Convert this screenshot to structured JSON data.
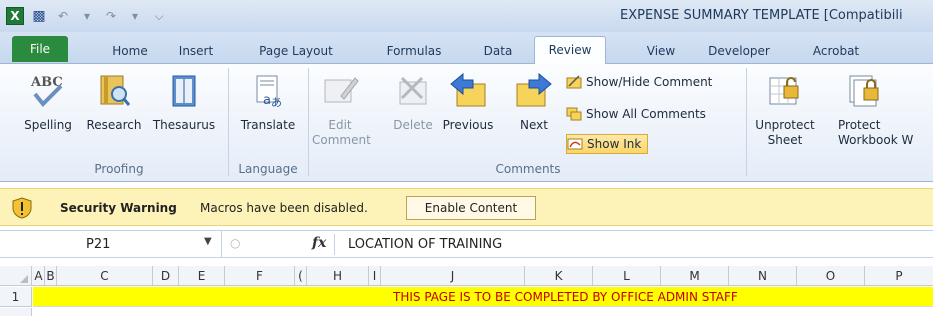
{
  "window": {
    "title": "EXPENSE SUMMARY TEMPLATE  [Compatibili"
  },
  "tabs": [
    {
      "label": "File"
    },
    {
      "label": "Home"
    },
    {
      "label": "Insert"
    },
    {
      "label": "Page Layout"
    },
    {
      "label": "Formulas"
    },
    {
      "label": "Data"
    },
    {
      "label": "Review"
    },
    {
      "label": "View"
    },
    {
      "label": "Developer"
    },
    {
      "label": "Acrobat"
    }
  ],
  "ribbon": {
    "proofing": {
      "label": "Proofing",
      "spelling": "Spelling",
      "research": "Research",
      "thesaurus": "Thesaurus"
    },
    "language": {
      "label": "Language",
      "translate": "Translate"
    },
    "comments": {
      "label": "Comments",
      "edit_line1": "Edit",
      "edit_line2": "Comment",
      "delete": "Delete",
      "previous": "Previous",
      "next": "Next",
      "show_hide": "Show/Hide Comment",
      "show_all": "Show All Comments",
      "show_ink": "Show Ink"
    },
    "changes": {
      "unprotect_line1": "Unprotect",
      "unprotect_line2": "Sheet",
      "protect_line1": "Protect",
      "protect_line2": "Workbook W"
    }
  },
  "security_bar": {
    "title": "Security Warning",
    "message": "Macros have been disabled.",
    "button": "Enable Content"
  },
  "formula_bar": {
    "name_box": "P21",
    "fx": "fx",
    "formula": "LOCATION OF TRAINING"
  },
  "grid": {
    "columns": [
      "A",
      "B",
      "C",
      "D",
      "E",
      "F",
      "(",
      "H",
      "I",
      "J",
      "K",
      "L",
      "M",
      "N",
      "O",
      "P"
    ],
    "row1_number": "1",
    "row1_text": "THIS PAGE IS TO BE COMPLETED BY OFFICE ADMIN STAFF"
  },
  "colors": {
    "accent_file_tab": "#2a8a3d",
    "security_bar": "#fdf2b8",
    "row1_fill": "#ffff00",
    "row1_text": "#c00000"
  }
}
